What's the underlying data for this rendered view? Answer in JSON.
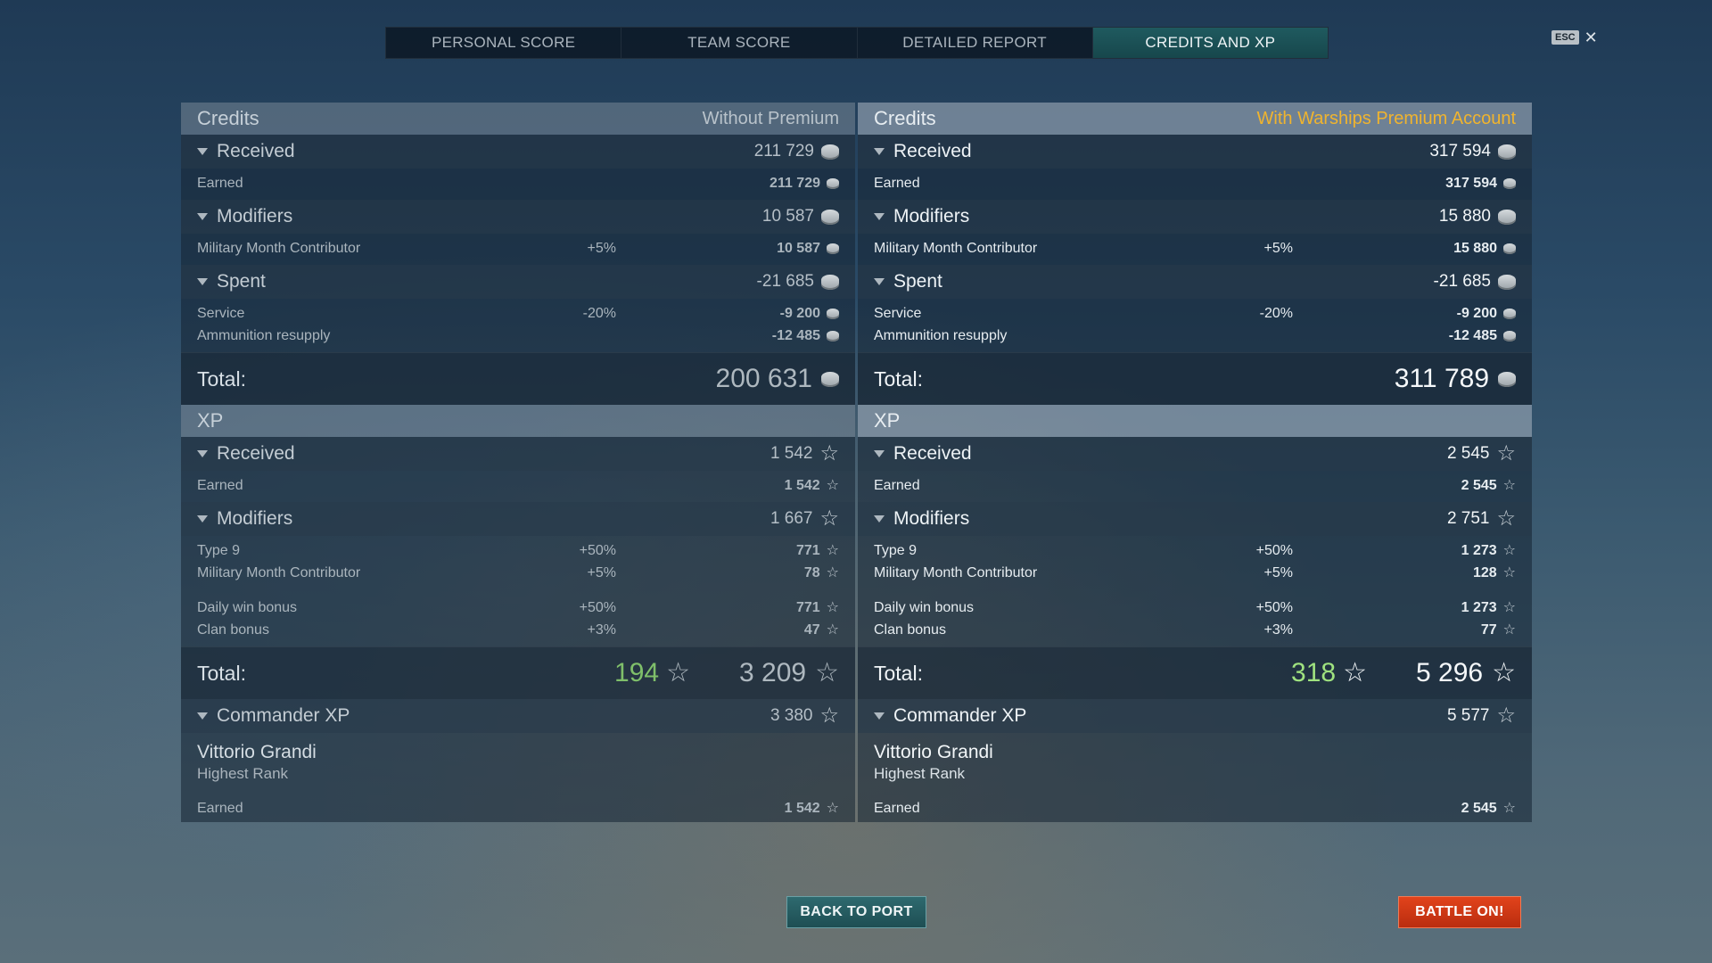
{
  "tabs": [
    "PERSONAL SCORE",
    "TEAM SCORE",
    "DETAILED REPORT",
    "CREDITS AND XP"
  ],
  "esc": {
    "badge": "ESC",
    "close": "✕"
  },
  "left": {
    "credits_title": "Credits",
    "credits_sub": "Without Premium",
    "received": {
      "label": "Received",
      "value": "211 729",
      "items": [
        {
          "name": "Earned",
          "pct": "",
          "amt": "211 729"
        }
      ]
    },
    "modifiers": {
      "label": "Modifiers",
      "value": "10 587",
      "items": [
        {
          "name": "Military Month Contributor",
          "pct": "+5%",
          "amt": "10 587"
        }
      ]
    },
    "spent": {
      "label": "Spent",
      "value": "-21 685",
      "items": [
        {
          "name": "Service",
          "pct": "-20%",
          "amt": "-9 200"
        },
        {
          "name": "Ammunition resupply",
          "pct": "",
          "amt": "-12 485"
        }
      ]
    },
    "credits_total": {
      "label": "Total:",
      "value": "200 631"
    },
    "xp_title": "XP",
    "xp_received": {
      "label": "Received",
      "value": "1 542",
      "items": [
        {
          "name": "Earned",
          "pct": "",
          "amt": "1 542"
        }
      ]
    },
    "xp_modifiers": {
      "label": "Modifiers",
      "value": "1 667",
      "items": [
        {
          "name": "Type 9",
          "pct": "+50%",
          "amt": "771"
        },
        {
          "name": "Military Month Contributor",
          "pct": "+5%",
          "amt": "78"
        }
      ],
      "items2": [
        {
          "name": "Daily win bonus",
          "pct": "+50%",
          "amt": "771"
        },
        {
          "name": "Clan bonus",
          "pct": "+3%",
          "amt": "47"
        }
      ]
    },
    "xp_total": {
      "label": "Total:",
      "free": "194",
      "value": "3 209"
    },
    "commander": {
      "label": "Commander XP",
      "value": "3 380",
      "name": "Vittorio Grandi",
      "rank": "Highest Rank",
      "earned_label": "Earned",
      "earned": "1 542"
    }
  },
  "right": {
    "credits_title": "Credits",
    "credits_sub": "With Warships Premium Account",
    "received": {
      "label": "Received",
      "value": "317 594",
      "items": [
        {
          "name": "Earned",
          "pct": "",
          "amt": "317 594"
        }
      ]
    },
    "modifiers": {
      "label": "Modifiers",
      "value": "15 880",
      "items": [
        {
          "name": "Military Month Contributor",
          "pct": "+5%",
          "amt": "15 880"
        }
      ]
    },
    "spent": {
      "label": "Spent",
      "value": "-21 685",
      "items": [
        {
          "name": "Service",
          "pct": "-20%",
          "amt": "-9 200"
        },
        {
          "name": "Ammunition resupply",
          "pct": "",
          "amt": "-12 485"
        }
      ]
    },
    "credits_total": {
      "label": "Total:",
      "value": "311 789"
    },
    "xp_title": "XP",
    "xp_received": {
      "label": "Received",
      "value": "2 545",
      "items": [
        {
          "name": "Earned",
          "pct": "",
          "amt": "2 545"
        }
      ]
    },
    "xp_modifiers": {
      "label": "Modifiers",
      "value": "2 751",
      "items": [
        {
          "name": "Type 9",
          "pct": "+50%",
          "amt": "1 273"
        },
        {
          "name": "Military Month Contributor",
          "pct": "+5%",
          "amt": "128"
        }
      ],
      "items2": [
        {
          "name": "Daily win bonus",
          "pct": "+50%",
          "amt": "1 273"
        },
        {
          "name": "Clan bonus",
          "pct": "+3%",
          "amt": "77"
        }
      ]
    },
    "xp_total": {
      "label": "Total:",
      "free": "318",
      "value": "5 296"
    },
    "commander": {
      "label": "Commander XP",
      "value": "5 577",
      "name": "Vittorio Grandi",
      "rank": "Highest Rank",
      "earned_label": "Earned",
      "earned": "2 545"
    }
  },
  "buttons": {
    "back": "BACK TO PORT",
    "battle": "BATTLE ON!"
  },
  "icons": {
    "credit": "credit-coin-icon",
    "xp": "xp-star-icon",
    "free_xp": "free-xp-star-icon"
  },
  "colors": {
    "premium_accent": "#f0b42e",
    "active_tab": "#1f5a5f",
    "battle_button": "#d93a18",
    "free_xp_green": "#9fe27f"
  }
}
